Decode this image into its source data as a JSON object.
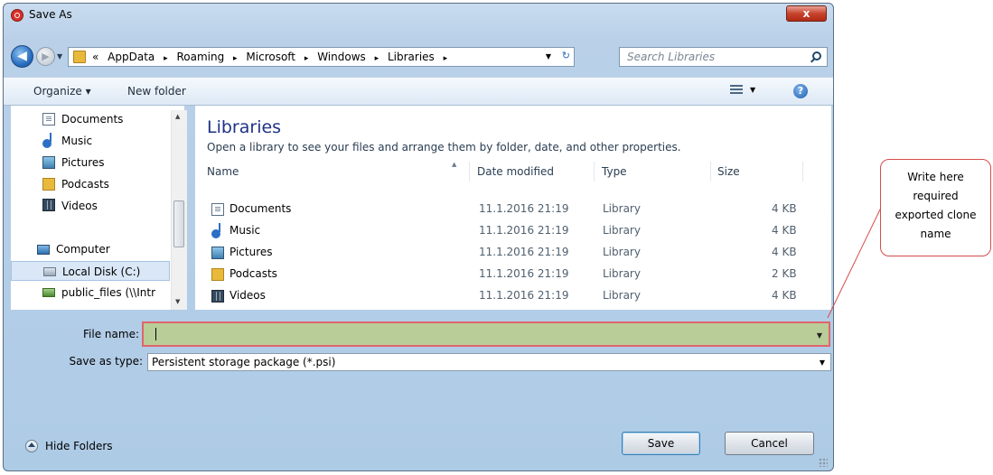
{
  "window": {
    "title": "Save As",
    "close_label": "x"
  },
  "nav": {
    "back_label": "◀",
    "forward_label": "▶",
    "breadcrumb_prefix": "«",
    "breadcrumbs": [
      "AppData",
      "Roaming",
      "Microsoft",
      "Windows",
      "Libraries"
    ],
    "crumb_separator": "▸",
    "search_placeholder": "Search Libraries"
  },
  "toolbar": {
    "organize_label": "Organize ▾",
    "new_folder_label": "New folder",
    "help_label": "?"
  },
  "sidebar": {
    "items": [
      {
        "label": "Documents",
        "icon": "document-icon"
      },
      {
        "label": "Music",
        "icon": "music-icon"
      },
      {
        "label": "Pictures",
        "icon": "pictures-icon"
      },
      {
        "label": "Podcasts",
        "icon": "folder-icon"
      },
      {
        "label": "Videos",
        "icon": "videos-icon"
      },
      {
        "label": "Computer",
        "icon": "computer-icon"
      },
      {
        "label": "Local Disk (C:)",
        "icon": "disk-icon"
      },
      {
        "label": "public_files (\\\\Intr",
        "icon": "network-drive-icon"
      }
    ]
  },
  "main": {
    "heading": "Libraries",
    "subheading": "Open a library to see your files and arrange them by folder, date, and other properties.",
    "columns": [
      "Name",
      "Date modified",
      "Type",
      "Size"
    ],
    "rows": [
      {
        "name": "Documents",
        "date": "11.1.2016 21:19",
        "type": "Library",
        "size": "4 KB"
      },
      {
        "name": "Music",
        "date": "11.1.2016 21:19",
        "type": "Library",
        "size": "4 KB"
      },
      {
        "name": "Pictures",
        "date": "11.1.2016 21:19",
        "type": "Library",
        "size": "4 KB"
      },
      {
        "name": "Podcasts",
        "date": "11.1.2016 21:19",
        "type": "Library",
        "size": "2 KB"
      },
      {
        "name": "Videos",
        "date": "11.1.2016 21:19",
        "type": "Library",
        "size": "4 KB"
      }
    ]
  },
  "form": {
    "file_name_label": "File name:",
    "file_name_value": "",
    "save_type_label": "Save as type:",
    "save_type_value": "Persistent storage package (*.psi)"
  },
  "footer": {
    "hide_folders_label": "Hide Folders",
    "save_label": "Save",
    "cancel_label": "Cancel"
  },
  "callout": {
    "lines": [
      "Write here",
      "required",
      "exported clone",
      "name"
    ]
  },
  "colors": {
    "highlight_fill": "#b8cd97",
    "highlight_border": "#e0656c",
    "accent": "#1e3287"
  }
}
